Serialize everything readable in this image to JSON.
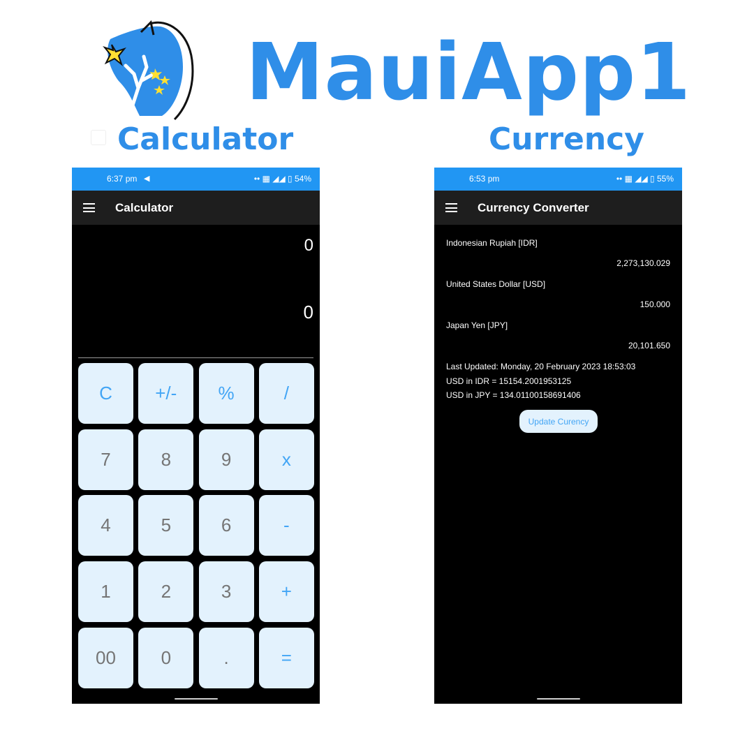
{
  "app": {
    "title": "MauiApp1"
  },
  "sections": {
    "calculator": "Calculator",
    "currency": "Currency"
  },
  "colors": {
    "accent": "#2f8ee8",
    "status_bar": "#2196f3",
    "key_bg": "#e3f2fd",
    "key_op": "#42a5f5",
    "key_num": "#757575"
  },
  "calculator_phone": {
    "status": {
      "time": "6:37 pm",
      "right": "•• ▦ ◢◢ ▯ 54%",
      "icon": "telegram-icon"
    },
    "app_bar": {
      "title": "Calculator",
      "icon": "hamburger-menu-icon"
    },
    "display": {
      "expression": "0",
      "result": "0"
    },
    "keys": [
      {
        "label": "C",
        "op": true
      },
      {
        "label": "+/-",
        "op": true
      },
      {
        "label": "%",
        "op": true
      },
      {
        "label": "/",
        "op": true
      },
      {
        "label": "7",
        "op": false
      },
      {
        "label": "8",
        "op": false
      },
      {
        "label": "9",
        "op": false
      },
      {
        "label": "x",
        "op": true
      },
      {
        "label": "4",
        "op": false
      },
      {
        "label": "5",
        "op": false
      },
      {
        "label": "6",
        "op": false
      },
      {
        "label": "-",
        "op": true
      },
      {
        "label": "1",
        "op": false
      },
      {
        "label": "2",
        "op": false
      },
      {
        "label": "3",
        "op": false
      },
      {
        "label": "+",
        "op": true
      },
      {
        "label": "00",
        "op": false
      },
      {
        "label": "0",
        "op": false
      },
      {
        "label": ".",
        "op": false
      },
      {
        "label": "=",
        "op": true
      }
    ]
  },
  "currency_phone": {
    "status": {
      "time": "6:53 pm",
      "right": "•• ▦ ◢◢ ▯ 55%"
    },
    "app_bar": {
      "title": "Currency Converter",
      "icon": "hamburger-menu-icon"
    },
    "rows": [
      {
        "label": "Indonesian Rupiah [IDR]",
        "value": "2,273,130.029"
      },
      {
        "label": "United States Dollar [USD]",
        "value": "150.000"
      },
      {
        "label": "Japan Yen [JPY]",
        "value": "20,101.650"
      }
    ],
    "last_updated": "Last Updated: Monday, 20 February 2023 18:53:03",
    "usd_idr": "USD in IDR = 15154.2001953125",
    "usd_jpy": "USD in JPY = 134.01100158691406",
    "update_button": "Update Curency"
  }
}
